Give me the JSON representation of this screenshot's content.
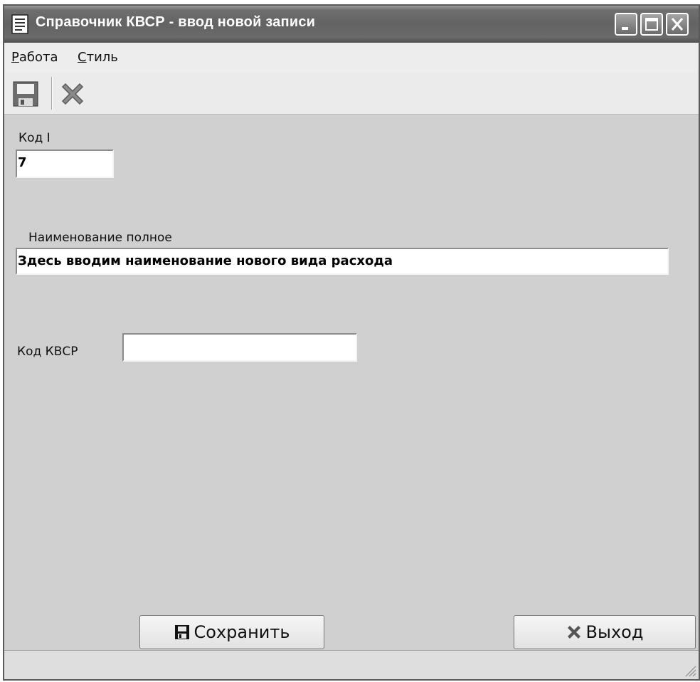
{
  "window": {
    "title": "Справочник КВСР - ввод новой записи"
  },
  "menu": {
    "items": [
      {
        "label": "Работа",
        "accel": "Р",
        "rest": "абота"
      },
      {
        "label": "Стиль",
        "accel": "С",
        "rest": "тиль"
      }
    ]
  },
  "toolbar": {
    "buttons": [
      {
        "icon": "floppy-disk-icon"
      },
      {
        "icon": "close-x-icon"
      }
    ]
  },
  "form": {
    "code_label": "Код I",
    "code_value": "7",
    "name_label": "Наименование полное",
    "name_value": "Здесь вводим наименование нового вида расхода",
    "kvsr_label": "Код КВСР",
    "kvsr_value": ""
  },
  "buttons": {
    "save_label": "Сохранить",
    "exit_label": "Выход"
  },
  "colors": {
    "titlebar": "#636363",
    "window_bg": "#d0d0d0",
    "field_bg": "#ffffff"
  }
}
